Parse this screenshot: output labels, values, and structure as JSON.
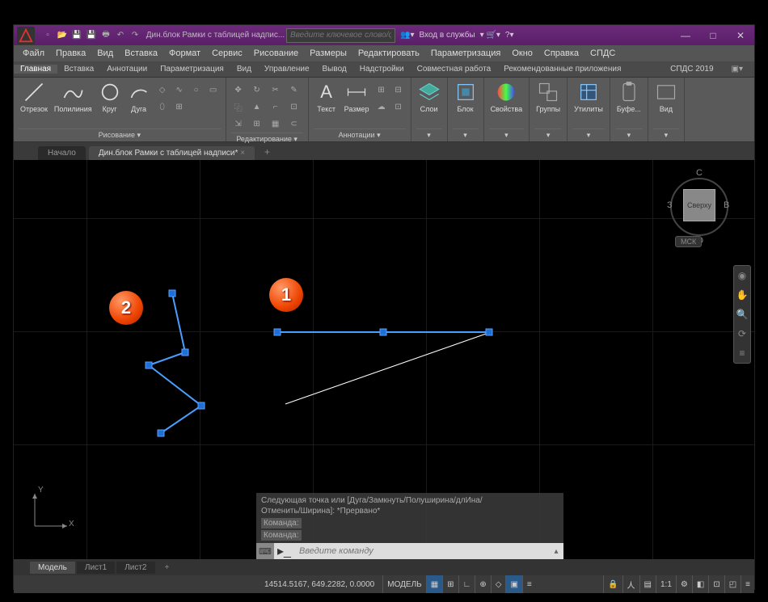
{
  "titlebar": {
    "title": "Дин.блок Рамки с таблицей надпис...",
    "search_ph": "Введите ключевое слово/фразу",
    "login": "Вход в службы"
  },
  "wbtns": {
    "min": "—",
    "max": "□",
    "close": "✕"
  },
  "menubar": [
    "Файл",
    "Правка",
    "Вид",
    "Вставка",
    "Формат",
    "Сервис",
    "Рисование",
    "Размеры",
    "Редактировать",
    "Параметризация",
    "Окно",
    "Справка",
    "СПДС"
  ],
  "ribbontabs": [
    "Главная",
    "Вставка",
    "Аннотации",
    "Параметризация",
    "Вид",
    "Управление",
    "Вывод",
    "Надстройки",
    "Совместная работа",
    "Рекомендованные приложения",
    "СПДС 2019"
  ],
  "panels": {
    "draw": {
      "line": "Отрезок",
      "pline": "Полилиния",
      "circle": "Круг",
      "arc": "Дуга",
      "label": "Рисование ▾"
    },
    "modify": {
      "label": "Редактирование ▾"
    },
    "annot": {
      "text": "Текст",
      "dim": "Размер",
      "label": "Аннотации ▾"
    },
    "layers": {
      "label": "Слои"
    },
    "block": {
      "label": "Блок"
    },
    "props": {
      "label": "Свойства"
    },
    "groups": {
      "label": "Группы"
    },
    "utils": {
      "label": "Утилиты"
    },
    "clip": {
      "label": "Буфе..."
    },
    "view": {
      "label": "Вид"
    }
  },
  "doctabs": {
    "start": "Начало",
    "active": "Дин.блок Рамки с таблицей надписи*"
  },
  "viewcube": {
    "top": "Сверху",
    "n": "С",
    "s": "Ю",
    "e": "В",
    "w": "З",
    "msk": "МСК"
  },
  "cmd": {
    "hist1": "Следующая точка или [Дуга/Замкнуть/Полуширина/длИна/",
    "hist2": "Отменить/Ширина]: *Прервано*",
    "prompt1": "Команда:",
    "prompt2": "Команда:",
    "placeholder": "Введите команду"
  },
  "annotations": {
    "one": "1",
    "two": "2"
  },
  "layouts": {
    "model": "Модель",
    "l1": "Лист1",
    "l2": "Лист2"
  },
  "status": {
    "coords": "14514.5167, 649.2282, 0.0000",
    "space": "МОДЕЛЬ",
    "scale": "1:1"
  },
  "ucs": {
    "x": "X",
    "y": "Y"
  }
}
